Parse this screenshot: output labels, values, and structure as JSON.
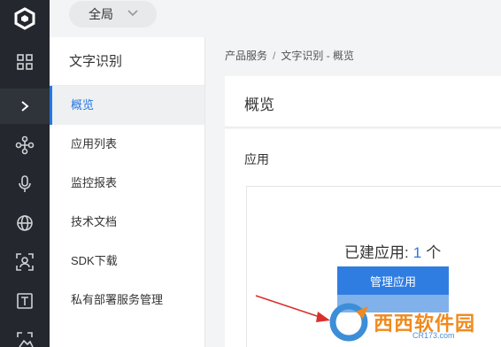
{
  "topbar": {
    "scope_label": "全局"
  },
  "rail": {
    "icons": [
      "logo-icon",
      "grid-icon",
      "expand-icon",
      "network-icon",
      "microphone-icon",
      "globe-icon",
      "face-scan-icon",
      "text-icon",
      "image-icon"
    ]
  },
  "subnav": {
    "title": "文字识别",
    "items": [
      {
        "label": "概览",
        "active": true
      },
      {
        "label": "应用列表"
      },
      {
        "label": "监控报表"
      },
      {
        "label": "技术文档"
      },
      {
        "label": "SDK下载"
      },
      {
        "label": "私有部署服务管理"
      }
    ]
  },
  "breadcrumb": {
    "root": "产品服务",
    "separator": "/",
    "current": "文字识别 - 概览"
  },
  "main": {
    "header": "概览",
    "section_title": "应用",
    "created_prefix": "已建应用:",
    "created_count": "1",
    "created_unit": "个",
    "manage_button": "管理应用"
  },
  "watermark": {
    "text": "西西软件园",
    "url": "CR173.com"
  },
  "colors": {
    "accent": "#2577e3",
    "rail_bg": "#24272d",
    "button": "#2f7de1"
  }
}
